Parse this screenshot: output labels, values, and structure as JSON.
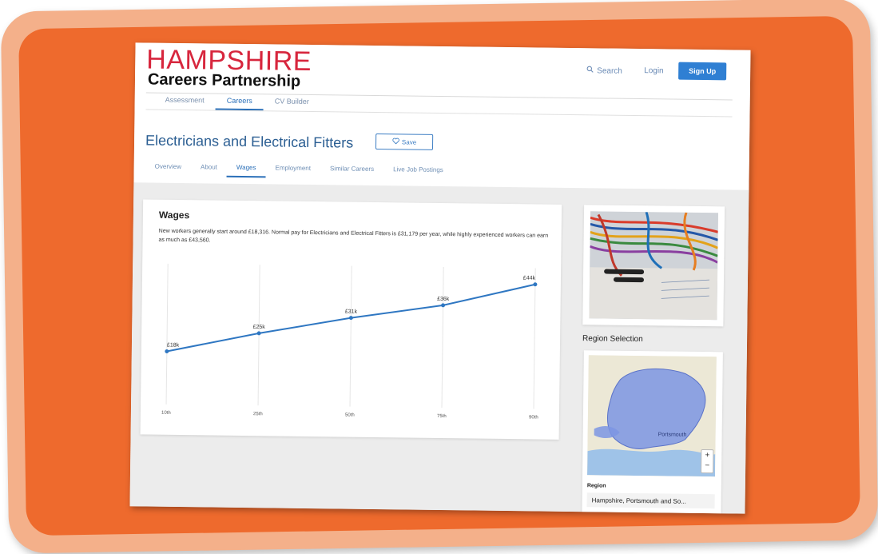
{
  "brand": {
    "name_top": "HAMPSHIRE",
    "name_bottom": "Careers Partnership"
  },
  "header": {
    "search_label": "Search",
    "login_label": "Login",
    "signup_label": "Sign Up"
  },
  "nav": {
    "items": [
      "Assessment",
      "Careers",
      "CV Builder"
    ],
    "active_index": 1
  },
  "career": {
    "title": "Electricians and Electrical Fitters",
    "save_label": "Save"
  },
  "tabs": {
    "items": [
      "Overview",
      "About",
      "Wages",
      "Employment",
      "Similar Careers",
      "Live Job Postings"
    ],
    "active_index": 2
  },
  "wages": {
    "title": "Wages",
    "description": "New workers generally start around £18,316. Normal pay for Electricians and Electrical Fitters is £31,179 per year, while highly experienced workers can earn as much as £43,560."
  },
  "chart_data": {
    "type": "line",
    "categories": [
      "10th",
      "25th",
      "50th",
      "75th",
      "90th"
    ],
    "values": [
      18,
      25,
      31,
      36,
      44
    ],
    "point_labels": [
      "£18k",
      "£25k",
      "£31k",
      "£36k",
      "£44k"
    ],
    "grid": "vertical",
    "color": "#2f77c2"
  },
  "sidebar": {
    "region_heading": "Region Selection",
    "region_field_label": "Region",
    "region_selected": "Hampshire, Portsmouth and So...",
    "map_place_label": "Portsmouth",
    "zoom_in": "+",
    "zoom_out": "−"
  },
  "colors": {
    "frame_outer": "#f4b08a",
    "frame_inner": "#ee6a2d",
    "brand_red": "#d7263d",
    "accent_blue": "#2f7fd3"
  }
}
